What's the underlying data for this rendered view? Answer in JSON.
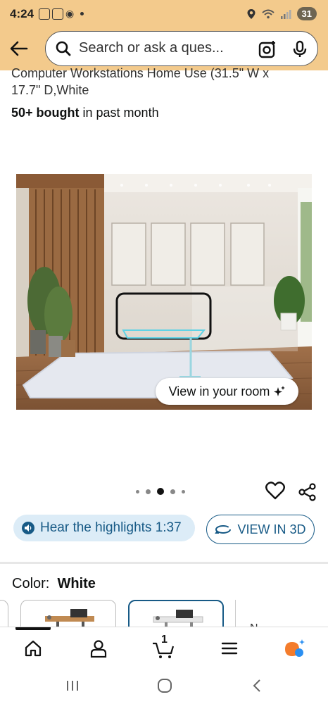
{
  "status_bar": {
    "time": "4:24",
    "battery": "31"
  },
  "search": {
    "placeholder": "Search or ask a ques..."
  },
  "product": {
    "title_partial_line1": "Computer Workstations Home Use  (31.5\" W x",
    "title_partial_line2": "17.7\" D,White",
    "bought_strong": "50+ bought",
    "bought_rest": " in past month"
  },
  "image": {
    "view_in_room_label": "View in your room",
    "carousel_total": 5,
    "carousel_active_index": 2
  },
  "actions": {
    "hear_highlights_label": "Hear the highlights 1:37",
    "view_3d_label": "VIEW IN 3D"
  },
  "variant": {
    "color_label": "Color:",
    "color_value": "White",
    "next_swatch_text": "N"
  },
  "nav": {
    "items": [
      "home",
      "account",
      "cart",
      "menu",
      "rufus"
    ],
    "cart_count": "1"
  },
  "colors": {
    "header_bg": "#f3ca8c",
    "link_blue": "#175a86",
    "highlight_bg": "#dcecf7",
    "rufus_orange": "#f47c2c",
    "rufus_blue": "#2a8ff2"
  }
}
